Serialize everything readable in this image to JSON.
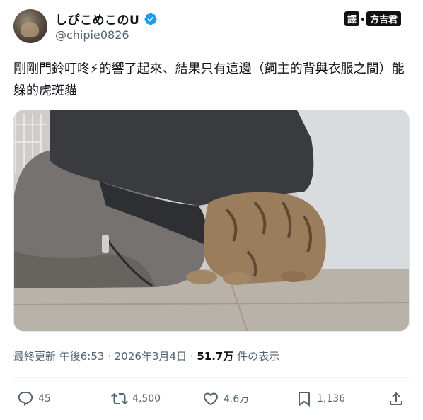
{
  "user": {
    "display_name": "しぴこめこのU",
    "handle": "@chipie0826",
    "verified": true
  },
  "watermark": {
    "tag": "譯",
    "brand": "方吉君"
  },
  "post": {
    "text": "剛剛門鈴叮咚⚡的響了起來、結果只有這邊（飼主的背與衣服之間）能躲的虎斑貓"
  },
  "meta": {
    "time": "最終更新 午後6:53",
    "sep1": " · ",
    "date": "2026年3月4日",
    "sep2": " · ",
    "views": "51.7万",
    "views_suffix": " 件の表示"
  },
  "actions": {
    "replies": "45",
    "reposts": "4,500",
    "likes": "4.6万",
    "bookmarks": "1,136"
  },
  "colors": {
    "verified": "#1d9bf0",
    "secondary_text": "#536471",
    "primary_text": "#0f1419"
  }
}
